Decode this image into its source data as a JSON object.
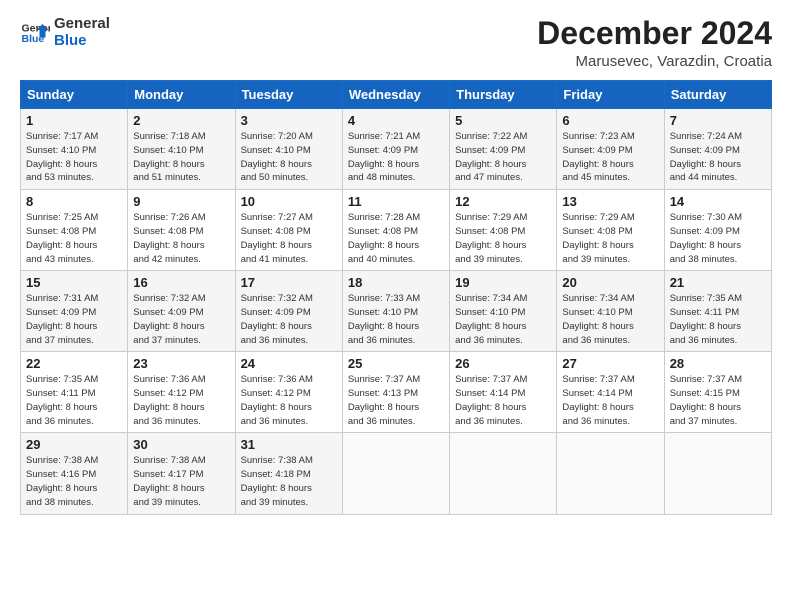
{
  "header": {
    "logo_line1": "General",
    "logo_line2": "Blue",
    "month_title": "December 2024",
    "location": "Marusevec, Varazdin, Croatia"
  },
  "weekdays": [
    "Sunday",
    "Monday",
    "Tuesday",
    "Wednesday",
    "Thursday",
    "Friday",
    "Saturday"
  ],
  "weeks": [
    [
      {
        "day": "1",
        "info": "Sunrise: 7:17 AM\nSunset: 4:10 PM\nDaylight: 8 hours\nand 53 minutes."
      },
      {
        "day": "2",
        "info": "Sunrise: 7:18 AM\nSunset: 4:10 PM\nDaylight: 8 hours\nand 51 minutes."
      },
      {
        "day": "3",
        "info": "Sunrise: 7:20 AM\nSunset: 4:10 PM\nDaylight: 8 hours\nand 50 minutes."
      },
      {
        "day": "4",
        "info": "Sunrise: 7:21 AM\nSunset: 4:09 PM\nDaylight: 8 hours\nand 48 minutes."
      },
      {
        "day": "5",
        "info": "Sunrise: 7:22 AM\nSunset: 4:09 PM\nDaylight: 8 hours\nand 47 minutes."
      },
      {
        "day": "6",
        "info": "Sunrise: 7:23 AM\nSunset: 4:09 PM\nDaylight: 8 hours\nand 45 minutes."
      },
      {
        "day": "7",
        "info": "Sunrise: 7:24 AM\nSunset: 4:09 PM\nDaylight: 8 hours\nand 44 minutes."
      }
    ],
    [
      {
        "day": "8",
        "info": "Sunrise: 7:25 AM\nSunset: 4:08 PM\nDaylight: 8 hours\nand 43 minutes."
      },
      {
        "day": "9",
        "info": "Sunrise: 7:26 AM\nSunset: 4:08 PM\nDaylight: 8 hours\nand 42 minutes."
      },
      {
        "day": "10",
        "info": "Sunrise: 7:27 AM\nSunset: 4:08 PM\nDaylight: 8 hours\nand 41 minutes."
      },
      {
        "day": "11",
        "info": "Sunrise: 7:28 AM\nSunset: 4:08 PM\nDaylight: 8 hours\nand 40 minutes."
      },
      {
        "day": "12",
        "info": "Sunrise: 7:29 AM\nSunset: 4:08 PM\nDaylight: 8 hours\nand 39 minutes."
      },
      {
        "day": "13",
        "info": "Sunrise: 7:29 AM\nSunset: 4:08 PM\nDaylight: 8 hours\nand 39 minutes."
      },
      {
        "day": "14",
        "info": "Sunrise: 7:30 AM\nSunset: 4:09 PM\nDaylight: 8 hours\nand 38 minutes."
      }
    ],
    [
      {
        "day": "15",
        "info": "Sunrise: 7:31 AM\nSunset: 4:09 PM\nDaylight: 8 hours\nand 37 minutes."
      },
      {
        "day": "16",
        "info": "Sunrise: 7:32 AM\nSunset: 4:09 PM\nDaylight: 8 hours\nand 37 minutes."
      },
      {
        "day": "17",
        "info": "Sunrise: 7:32 AM\nSunset: 4:09 PM\nDaylight: 8 hours\nand 36 minutes."
      },
      {
        "day": "18",
        "info": "Sunrise: 7:33 AM\nSunset: 4:10 PM\nDaylight: 8 hours\nand 36 minutes."
      },
      {
        "day": "19",
        "info": "Sunrise: 7:34 AM\nSunset: 4:10 PM\nDaylight: 8 hours\nand 36 minutes."
      },
      {
        "day": "20",
        "info": "Sunrise: 7:34 AM\nSunset: 4:10 PM\nDaylight: 8 hours\nand 36 minutes."
      },
      {
        "day": "21",
        "info": "Sunrise: 7:35 AM\nSunset: 4:11 PM\nDaylight: 8 hours\nand 36 minutes."
      }
    ],
    [
      {
        "day": "22",
        "info": "Sunrise: 7:35 AM\nSunset: 4:11 PM\nDaylight: 8 hours\nand 36 minutes."
      },
      {
        "day": "23",
        "info": "Sunrise: 7:36 AM\nSunset: 4:12 PM\nDaylight: 8 hours\nand 36 minutes."
      },
      {
        "day": "24",
        "info": "Sunrise: 7:36 AM\nSunset: 4:12 PM\nDaylight: 8 hours\nand 36 minutes."
      },
      {
        "day": "25",
        "info": "Sunrise: 7:37 AM\nSunset: 4:13 PM\nDaylight: 8 hours\nand 36 minutes."
      },
      {
        "day": "26",
        "info": "Sunrise: 7:37 AM\nSunset: 4:14 PM\nDaylight: 8 hours\nand 36 minutes."
      },
      {
        "day": "27",
        "info": "Sunrise: 7:37 AM\nSunset: 4:14 PM\nDaylight: 8 hours\nand 36 minutes."
      },
      {
        "day": "28",
        "info": "Sunrise: 7:37 AM\nSunset: 4:15 PM\nDaylight: 8 hours\nand 37 minutes."
      }
    ],
    [
      {
        "day": "29",
        "info": "Sunrise: 7:38 AM\nSunset: 4:16 PM\nDaylight: 8 hours\nand 38 minutes."
      },
      {
        "day": "30",
        "info": "Sunrise: 7:38 AM\nSunset: 4:17 PM\nDaylight: 8 hours\nand 39 minutes."
      },
      {
        "day": "31",
        "info": "Sunrise: 7:38 AM\nSunset: 4:18 PM\nDaylight: 8 hours\nand 39 minutes."
      },
      {
        "day": "",
        "info": ""
      },
      {
        "day": "",
        "info": ""
      },
      {
        "day": "",
        "info": ""
      },
      {
        "day": "",
        "info": ""
      }
    ]
  ]
}
